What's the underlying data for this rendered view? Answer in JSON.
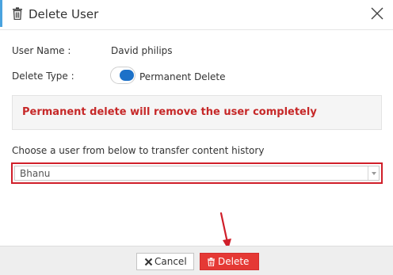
{
  "dialog": {
    "title": "Delete User",
    "title_icon": "trash-icon",
    "close_icon": "close-icon"
  },
  "form": {
    "user_name_label": "User Name :",
    "user_name_value": "David philips",
    "delete_type_label": "Delete Type :",
    "delete_type_value": "Permanent Delete",
    "delete_type_toggle_on": true
  },
  "warning": {
    "text": "Permanent delete will remove the user completely",
    "color": "#c62828"
  },
  "transfer": {
    "label": "Choose a user from below to transfer content history",
    "selected_user": "Bhanu"
  },
  "footer": {
    "cancel_label": "Cancel",
    "cancel_icon": "close-icon",
    "delete_label": "Delete",
    "delete_icon": "trash-icon"
  },
  "colors": {
    "accent": "#4aa3df",
    "toggle": "#1d71c8",
    "danger": "#e53935",
    "highlight_outline": "#d01f2a"
  },
  "annotations": {
    "arrow_icon": "red-arrow-icon"
  }
}
